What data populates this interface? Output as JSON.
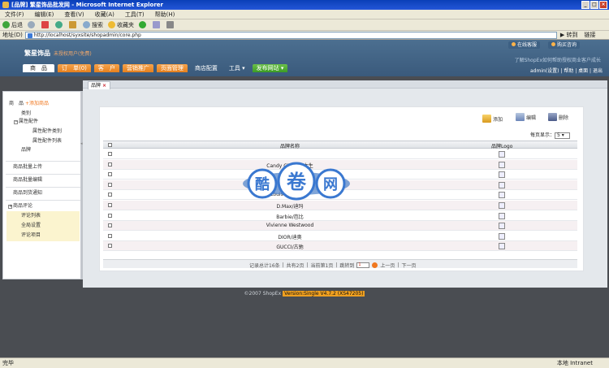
{
  "browser": {
    "title": "[品牌] 繁星饰品批发网 - Microsoft Internet Explorer",
    "menu": [
      "文件(F)",
      "编辑(E)",
      "查看(V)",
      "收藏(A)",
      "工具(T)",
      "帮助(H)"
    ],
    "toolbar": [
      "后退",
      "搜索",
      "收藏夹"
    ],
    "address_label": "地址(D)",
    "address": "http://localhost/syxsite/shopadmin/core.php",
    "go": "转到",
    "links": "链接",
    "status": "完毕",
    "zone": "本地 Intranet"
  },
  "header": {
    "site_name": "繁星饰品",
    "notice": "未授权用户(免费)",
    "service_links": [
      "在线客服",
      "购买咨询"
    ],
    "grow_text": "了解ShopEx如何帮助授权商业客户成长",
    "user_links": "admin(设置) | 帮助 | 桌面 | 退出",
    "nav": [
      {
        "label": "商　品",
        "style": "active"
      },
      {
        "label": "订　单(0)",
        "style": "orange"
      },
      {
        "label": "客　户",
        "style": "orange"
      },
      {
        "label": "营销推广",
        "style": "orange"
      },
      {
        "label": "页面管理",
        "style": "orange"
      },
      {
        "label": "商店配置",
        "style": "plain"
      },
      {
        "label": "工具 ▾",
        "style": "plain"
      },
      {
        "label": "发布网站 ▾",
        "style": "green"
      }
    ]
  },
  "sidebar": {
    "header": "商　品",
    "add_link": "+添加商品",
    "tree": [
      "类别",
      "属性配件",
      "属性配件类别",
      "属性配件列表",
      "品牌"
    ],
    "links": [
      "商品批量上传",
      "商品批量编辑",
      "商品到货通知"
    ],
    "comments": "商品评论",
    "comment_items": [
      "评论列表",
      "全局设置",
      "评论项目"
    ]
  },
  "tab": {
    "label": "品牌",
    "close": "×"
  },
  "actions": {
    "add": "添加",
    "edit": "编辑",
    "delete": "删除"
  },
  "perpage": {
    "label": "每页显示：",
    "value": "5"
  },
  "table": {
    "headers": [
      "品牌名称",
      "品牌Logo"
    ],
    "rows": [
      "",
      "Candy Girl/糖果女生",
      "",
      "",
      "Louis Vuitton/LV",
      "D.Max/迪玛",
      "Barbie/芭比",
      "Vivienne Westwood",
      "DIOR/迪奥",
      "GUCCI/古驰"
    ]
  },
  "pager": {
    "total": "记录总计16条",
    "pages": "共有2页",
    "current": "当前第1页",
    "jump": "跳转到",
    "page_value": "1",
    "prev": "上一页",
    "next": "下一页"
  },
  "footer": {
    "copyright": "©2007 ShopEx",
    "version": "Version:Single V4.7.2 (XS47205)"
  },
  "watermark": {
    "chars": [
      "酷",
      "卷",
      "网"
    ]
  }
}
